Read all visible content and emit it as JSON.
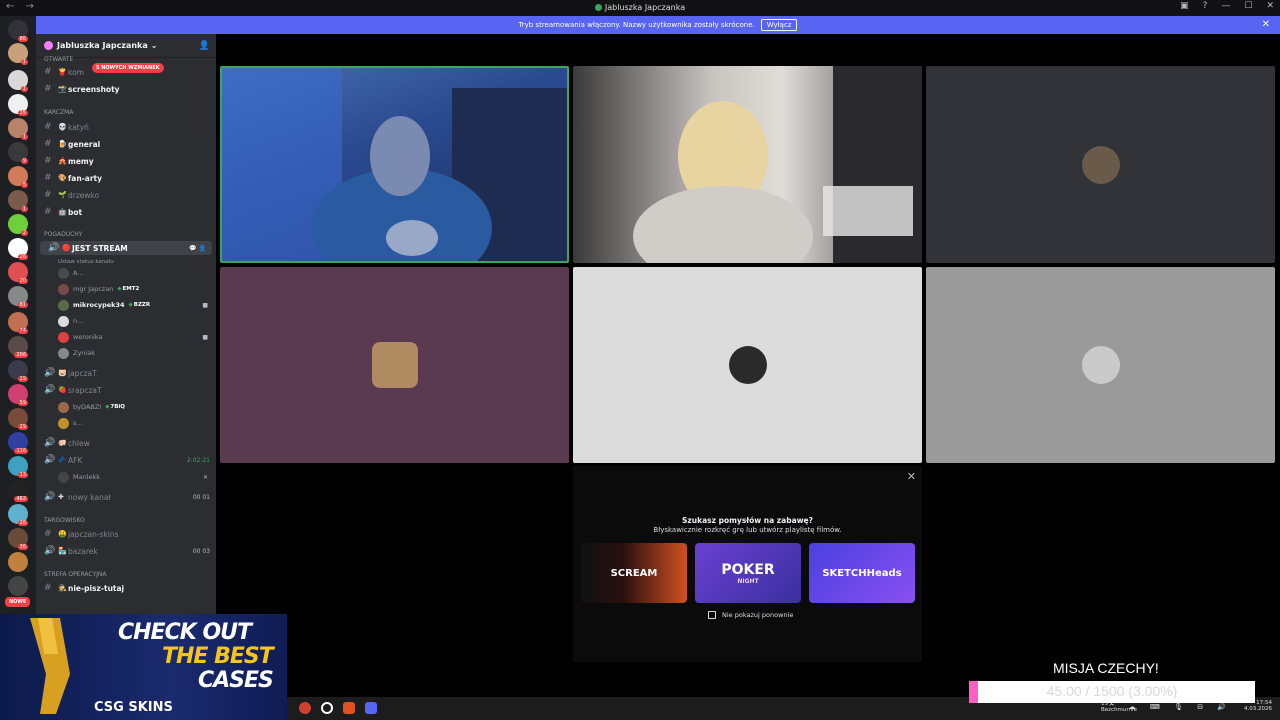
{
  "window": {
    "title": "Jabluszka Japczanka"
  },
  "banner": {
    "text": "Tryb streamowania włączony. Nazwy użytkownika zostały skrócone.",
    "button": "Wyłącz"
  },
  "server": {
    "name": "Jabluszka Japczanka"
  },
  "mention_badge": "5 NOWYCH WZMIANEK",
  "channels": {
    "cut_category": "OTWARTE",
    "cut_channel": "kom",
    "screenshoty": "screenshoty",
    "cat_karczma": "KARCZMA",
    "katyn": "katyń",
    "general": "general",
    "memy": "memy",
    "fanarty": "fan-arty",
    "drzewko": "drzewko",
    "bot": "bot",
    "cat_pogaduchy": "POGADUCHY",
    "jest_stream": "JEST STREAM",
    "status_hint": "Ustaw status kanału",
    "users_stream": [
      {
        "name": "A...",
        "tag": ""
      },
      {
        "name": "mgr Japczan",
        "tag": "EMT2"
      },
      {
        "name": "mikrocypek34",
        "tag": "BZZR"
      },
      {
        "name": "n...",
        "tag": ""
      },
      {
        "name": "weronika",
        "tag": ""
      },
      {
        "name": "Zyniak",
        "tag": ""
      }
    ],
    "japczat": "japczaT",
    "srapczat": "srapczaT",
    "users_srap": [
      {
        "name": "byDABZI",
        "tag": "7BiQ"
      },
      {
        "name": "s...",
        "tag": ""
      }
    ],
    "chlew": "chlew",
    "afk": "AFK",
    "afk_timer": "2:02:21",
    "afk_user": "Manlekk",
    "nowy_kanal": "nowy kanał",
    "nowy_count": "00   01",
    "cat_targowisko": "TARGOWISKO",
    "japczan_skins": "japczan-skins",
    "bazarek": "bazarek",
    "bazarek_count": "00   03",
    "cat_strefa": "STREFA OPERACYJNA",
    "nie_pisz": "nie-pisz-tutaj"
  },
  "promo": {
    "question": "Szukasz pomysłów na zabawę?",
    "subtext": "Błyskawicznie rozkręć grę lub utwórz playlistę filmów.",
    "activities": [
      "SCREAM",
      "POKER",
      "SKETCHHeads"
    ],
    "poker_sub": "NIGHT",
    "checkbox": "Nie pokazuj ponownie"
  },
  "rail_badges": [
    "86",
    "1",
    "1",
    "35",
    "1",
    "9",
    "5",
    "1",
    "2",
    "26",
    "20",
    "81",
    "74",
    "206",
    "19",
    "59",
    "29",
    "116",
    "13",
    "462",
    "26",
    "36"
  ],
  "ad": {
    "line1": "CHECK OUT",
    "line2": "THE BEST",
    "line3": "CASES",
    "brand": "CSG SKINS",
    "new_badge": "NOWE"
  },
  "mission": {
    "title": "MISJA CZECHY!",
    "progress_text": "45.00 / 1500 (3.00%)",
    "progress_fraction": 0.03
  },
  "taskbar": {
    "weather": "Bezchmurnie",
    "temp": "15°C",
    "time": "17:54",
    "date": "4.03.2026"
  },
  "colors": {
    "accent": "#5865f2",
    "speaking_border": "#3ba55d",
    "mission_fill": "#ff5ec4"
  }
}
